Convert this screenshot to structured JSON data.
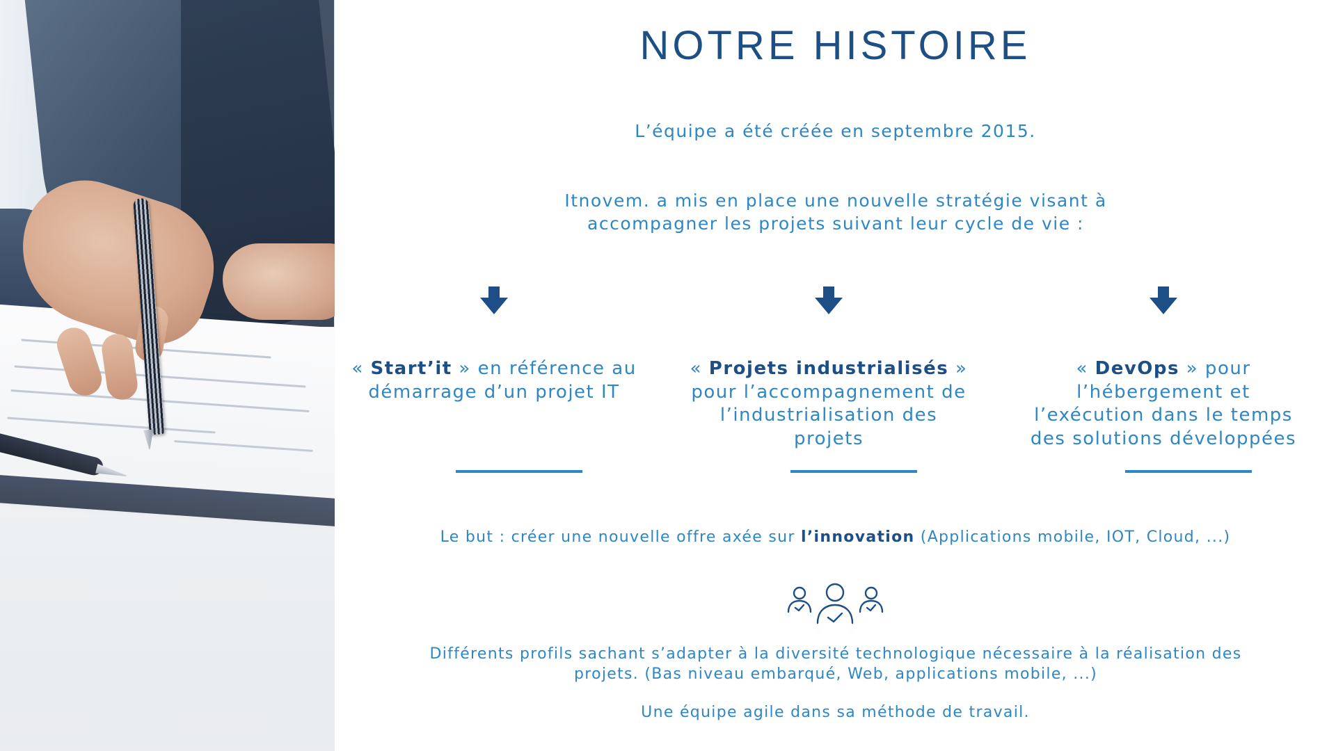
{
  "page": {
    "title": "NOTRE HISTOIRE",
    "intro_line1": "L’équipe a été créée en septembre 2015.",
    "intro_line2": "Itnovem. a mis en place une nouvelle stratégie visant à accompagner les projets suivant leur cycle de vie :"
  },
  "columns": [
    {
      "open": "« ",
      "highlight": "Start’it",
      "text": " » en référence au démarrage d’un projet IT"
    },
    {
      "open": "« ",
      "highlight": "Projets industrialisés",
      "text": " » pour l’accompagnement de l’industrialisation des projets"
    },
    {
      "open": "« ",
      "highlight": "DevOps",
      "text": " »  pour l’hébergement et l’exécution dans le temps des solutions développées"
    }
  ],
  "goal": {
    "prefix": "Le but : créer une nouvelle offre axée sur ",
    "highlight": "l’innovation",
    "suffix": " (Applications mobile, IOT, Cloud, ...)"
  },
  "profiles": "Différents profils sachant s’adapter à la diversité technologique nécessaire à la réalisation des projets. (Bas niveau embarqué, Web, applications mobile, ...)",
  "agile": "Une équipe agile dans sa méthode de travail.",
  "colors": {
    "title": "#1d4e86",
    "text": "#2f86c5",
    "rule": "#2f86c5"
  },
  "icons": {
    "arrow": "arrow-down-icon",
    "team": "team-users-icon"
  }
}
